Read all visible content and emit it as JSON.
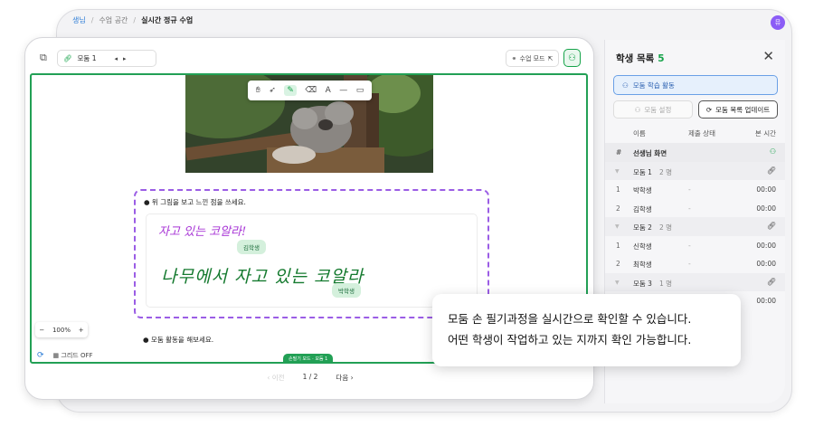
{
  "breadcrumb": {
    "first": "생님",
    "second": "수업 공간",
    "current": "실시간 정규 수업"
  },
  "avatar": {
    "initial": "뮤"
  },
  "toolbar": {
    "group_label": "모둠 1",
    "class_mode_label": "수업 모드",
    "icons": [
      "layers-icon",
      "link-icon",
      "arrow-left-icon",
      "arrow-right-icon",
      "class-mode-icon",
      "external-link-icon",
      "people-icon"
    ]
  },
  "drawing_tools": [
    "hand",
    "pointer",
    "pen",
    "eraser",
    "text",
    "line",
    "shape"
  ],
  "question1": "● 위 그림을 보고 느낀 점을 쓰세요.",
  "handwriting1": "자고 있는 코알라!",
  "handwriting2": "나무에서 자고 있는 코알라",
  "tags": {
    "first": "김학생",
    "second": "박학생"
  },
  "zoom": {
    "minus": "−",
    "value": "100%",
    "plus": "+"
  },
  "question2": "● 모둠 활동을 해보세요.",
  "grid_label": "그리드 OFF",
  "status_pill": "손필기 모드 · 모둠 1",
  "pager": {
    "prev": "이전",
    "page": "1 / 2",
    "next": "다음"
  },
  "panel": {
    "title": "학생 목록",
    "count": "5",
    "activity_button": "모둠 학습 활동",
    "settings_button": "모둠 설정",
    "update_button": "모둠 목록 업데이트",
    "columns": {
      "name": "이름",
      "status": "제출 상태",
      "time": "본 시간"
    },
    "teacher": {
      "num": "#",
      "name": "선생님 화면"
    },
    "groups": [
      {
        "name": "모둠 1",
        "count": "2 명",
        "students": [
          {
            "num": "1",
            "name": "박학생",
            "status": "-",
            "time": "00:00"
          },
          {
            "num": "2",
            "name": "김학생",
            "status": "-",
            "time": "00:00"
          }
        ]
      },
      {
        "name": "모둠 2",
        "count": "2 명",
        "students": [
          {
            "num": "1",
            "name": "신학생",
            "status": "-",
            "time": "00:00"
          },
          {
            "num": "2",
            "name": "최학생",
            "status": "-",
            "time": "00:00"
          }
        ]
      },
      {
        "name": "모둠 3",
        "count": "1 명",
        "students": [
          {
            "num": "1",
            "name": "",
            "status": "",
            "time": "00:00"
          }
        ]
      }
    ]
  },
  "callout": {
    "line1": "모둠 손 필기과정을 실시간으로  확인할 수 있습니다.",
    "line2": "어떤 학생이 작업하고 있는 지까지 확인 가능합니다."
  }
}
